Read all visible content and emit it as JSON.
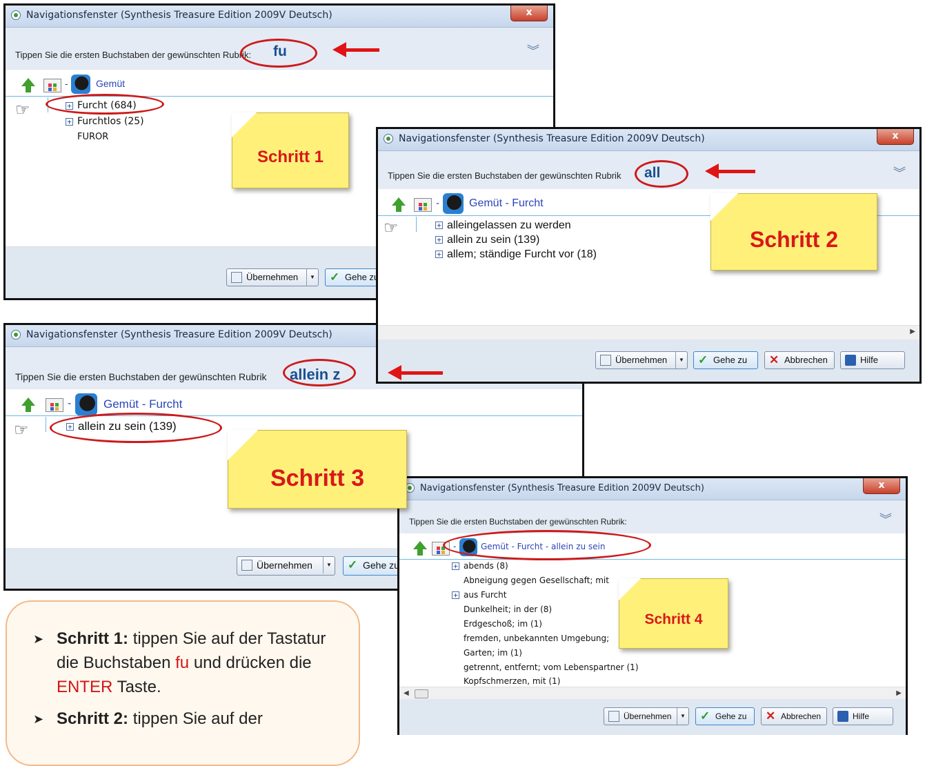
{
  "window_title": "Navigationsfenster (Synthesis Treasure Edition 2009V Deutsch)",
  "prompt": "Tippen Sie die ersten Buchstaben der gewünschten Rubrik:",
  "prompt_short": "Tippen Sie die ersten Buchstaben der gewünschten Rubrik",
  "close_label": "x",
  "buttons": {
    "apply": "Übernehmen",
    "goto": "Gehe zu",
    "goto_cut": "Gehe z",
    "cancel": "Abbrechen",
    "help": "Hilfe"
  },
  "window1": {
    "typed": "fu",
    "crumb": "Gemüt",
    "items": [
      "Furcht (684)",
      "Furchtlos (25)",
      "FUROR"
    ],
    "note": "Schritt 1"
  },
  "window2": {
    "typed": "all",
    "crumb": "Gemüt - Furcht",
    "items": [
      "alleingelassen zu werden",
      "allein zu sein (139)",
      "allem; ständige Furcht vor (18)"
    ],
    "note": "Schritt 2"
  },
  "window3": {
    "typed": "allein z",
    "crumb": "Gemüt - Furcht",
    "items": [
      "allein zu sein (139)"
    ],
    "note": "Schritt 3"
  },
  "window4": {
    "crumb": "Gemüt - Furcht - allein zu sein",
    "items": [
      "abends (8)",
      "Abneigung gegen Gesellschaft; mit",
      "aus Furcht",
      "Dunkelheit; in der (8)",
      "Erdgeschoß; im (1)",
      "fremden, unbekannten Umgebung;",
      "Garten; im (1)",
      "getrennt, entfernt; vom Lebenspartner (1)",
      "Kopfschmerzen, mit (1)"
    ],
    "note": "Schritt 4"
  },
  "instructions": {
    "step1_label": "Schritt 1:",
    "step1_a": "tippen Sie auf der Tastatur die Buchstaben",
    "step1_key1": "fu",
    "step1_b": "und drücken die",
    "step1_key2": "ENTER",
    "step1_c": "Taste.",
    "step2_label": "Schritt 2:",
    "step2_a": "tippen Sie auf der"
  },
  "colors": {
    "annotation_red": "#cc1a1a",
    "note_yellow": "#fff07a",
    "link_blue": "#2a45b8"
  }
}
